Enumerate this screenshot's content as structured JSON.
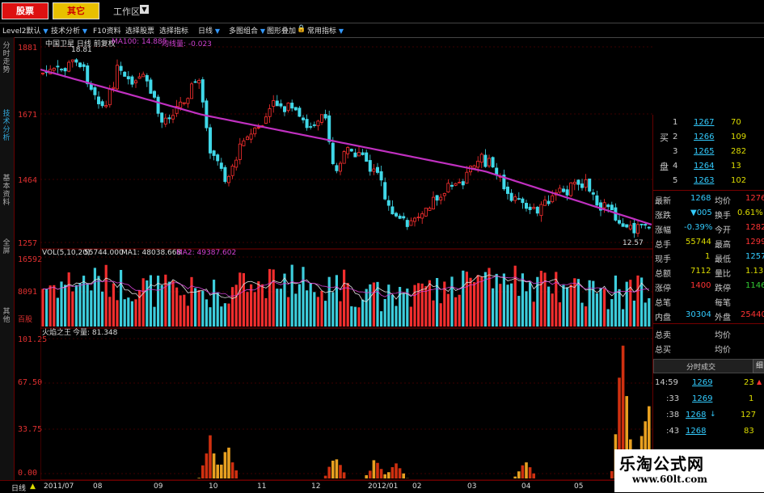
{
  "topbar": {
    "stock_btn": "股票",
    "other_btn": "其它",
    "workspace": "工作区"
  },
  "toolbar": {
    "items": [
      "Level2默认",
      "技术分析",
      "F10资料",
      "选择股票",
      "选择指标",
      "日线",
      "多图组合",
      "图形叠加",
      "常用指标"
    ]
  },
  "leftbar": {
    "tabs": [
      "分时走势",
      "技术分析",
      "基本资料",
      "全屏",
      "其他"
    ]
  },
  "price_panel": {
    "header": "中国卫星 日线 前复权",
    "ma_label": "MA100: 14.885",
    "ma_label2": "均线量: -0.023",
    "axis": [
      "1881",
      "1671",
      "1464",
      "1257"
    ],
    "high_mark": "18.81",
    "low_mark": "12.57"
  },
  "volume_panel": {
    "header": "VOL(5,10,20)",
    "vol": "55744.000",
    "ma1": "MA1: 48038.668",
    "ma2": "MA2: 49387.602",
    "axis": [
      "16592",
      "8091",
      "百股"
    ]
  },
  "indicator_panel": {
    "header": "火焰之王",
    "value": "今量: 81.348",
    "axis": [
      "101.25",
      "67.50",
      "33.75",
      "0.00"
    ]
  },
  "order_book": {
    "side_labels": [
      "买",
      "盘"
    ],
    "rows": [
      {
        "n": "1",
        "price": "1267",
        "vol": "70"
      },
      {
        "n": "2",
        "price": "1266",
        "vol": "109"
      },
      {
        "n": "3",
        "price": "1265",
        "vol": "282"
      },
      {
        "n": "4",
        "price": "1264",
        "vol": "13"
      },
      {
        "n": "5",
        "price": "1263",
        "vol": "102"
      }
    ]
  },
  "quote": {
    "latest_l": "最新",
    "latest_v": "1268",
    "avg_l": "均价",
    "avg_v": "1276",
    "chg_l": "涨跌",
    "chg_v": "▼005",
    "turn_l": "换手",
    "turn_v": "0.61%",
    "pct_l": "涨幅",
    "pct_v": "-0.39%",
    "open_l": "今开",
    "open_v": "1282",
    "total_l": "总手",
    "total_v": "55744",
    "high_l": "最高",
    "high_v": "1299",
    "now_l": "现手",
    "now_v": "1",
    "low_l": "最低",
    "low_v": "1257",
    "amt_l": "总额",
    "amt_v": "7112",
    "ratio_l": "量比",
    "ratio_v": "1.13",
    "up_l": "涨停",
    "up_v": "1400",
    "dn_l": "跌停",
    "dn_v": "1146",
    "cnt_l": "总笔",
    "each_l": "每笔",
    "in_l": "内盘",
    "in_v": "30304",
    "out_l": "外盘",
    "out_v": "25440",
    "sell_l": "总卖",
    "sellavg_l": "均价",
    "buy_l": "总买",
    "buyavg_l": "均价"
  },
  "ticks": {
    "title": "分时成交",
    "detail": "细",
    "rows": [
      {
        "t": "14:59",
        "p": "1269",
        "v": "23",
        "dir": "▲"
      },
      {
        "t": ":33",
        "p": "1269",
        "v": "1",
        "dir": ""
      },
      {
        "t": ":38",
        "p": "1268",
        "v": "127",
        "dir": "↓"
      },
      {
        "t": ":43",
        "p": "1268",
        "v": "83",
        "dir": ""
      }
    ]
  },
  "datebar": {
    "label": "日线",
    "dates": [
      "2011/07",
      "08",
      "09",
      "10",
      "11",
      "12",
      "2012/01",
      "02",
      "03",
      "04",
      "05"
    ]
  },
  "watermark": {
    "title": "乐淘公式网",
    "url": "www.60lt.com"
  },
  "colors": {
    "up": "#ff3030",
    "down": "#40d8e8",
    "ma": "#c030c0",
    "grid": "#7a0000"
  }
}
